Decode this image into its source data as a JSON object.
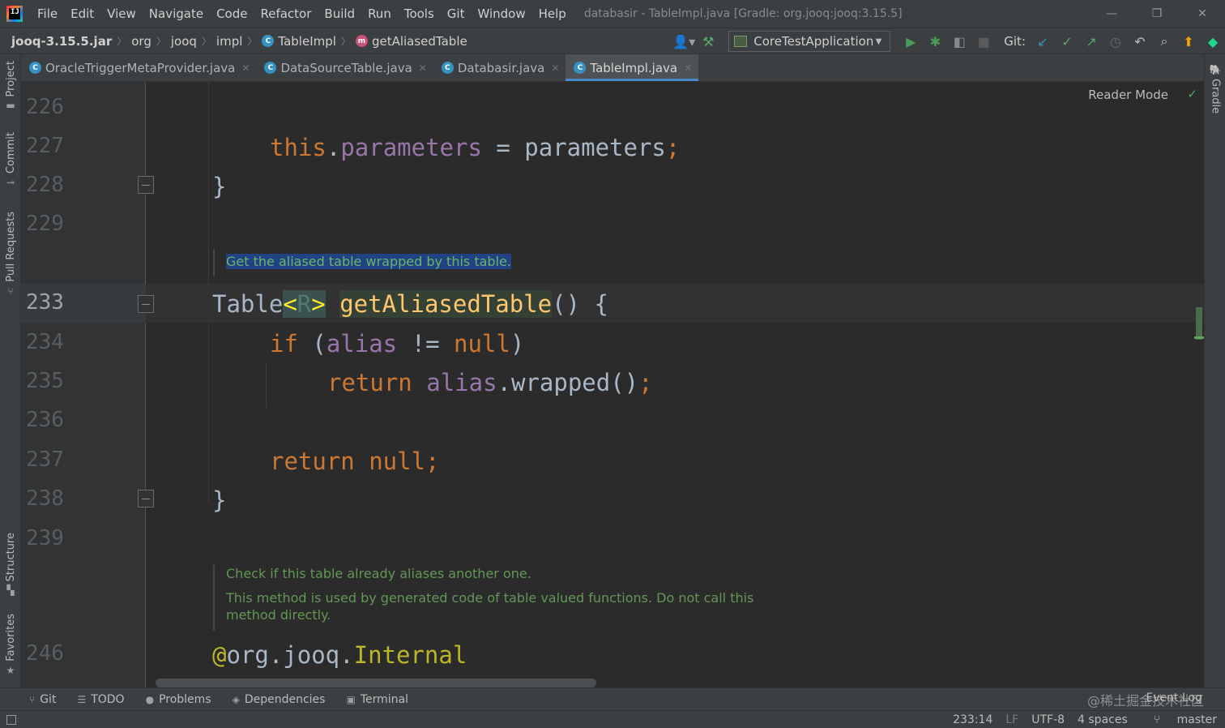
{
  "window": {
    "title": "databasir - TableImpl.java [Gradle: org.jooq:jooq:3.15.5]",
    "menu": [
      "File",
      "Edit",
      "View",
      "Navigate",
      "Code",
      "Refactor",
      "Build",
      "Run",
      "Tools",
      "Git",
      "Window",
      "Help"
    ],
    "controls": [
      "—",
      "❐",
      "✕"
    ]
  },
  "breadcrumbs": [
    "jooq-3.15.5.jar",
    "org",
    "jooq",
    "impl",
    "TableImpl",
    "getAliasedTable"
  ],
  "toolbar": {
    "run_config": "CoreTestApplication",
    "git_label": "Git:"
  },
  "tabs": [
    {
      "label": "OracleTriggerMetaProvider.java"
    },
    {
      "label": "DataSourceTable.java"
    },
    {
      "label": "Databasir.java"
    },
    {
      "label": "TableImpl.java",
      "active": true
    }
  ],
  "side_tools": {
    "left_top": [
      "Project",
      "Commit",
      "Pull Requests"
    ],
    "left_bottom": [
      "Structure",
      "Favorites"
    ],
    "right": [
      "Gradle"
    ]
  },
  "editor": {
    "reader_mode": "Reader Mode",
    "lines": [
      {
        "num": "226"
      },
      {
        "num": "227",
        "code": "this.parameters = parameters;"
      },
      {
        "num": "228",
        "code": "}"
      },
      {
        "num": "229"
      },
      {
        "num": "233",
        "code": "Table<R> getAliasedTable() {"
      },
      {
        "num": "234",
        "code": "if (alias != null)"
      },
      {
        "num": "235",
        "code": "return alias.wrapped();"
      },
      {
        "num": "236"
      },
      {
        "num": "237",
        "code": "return null;"
      },
      {
        "num": "238",
        "code": "}"
      },
      {
        "num": "239"
      },
      {
        "num": "246",
        "code": "@org.jooq.Internal"
      }
    ],
    "doc1": "Get the aliased table wrapped by this table.",
    "doc2_line1": "Check if this table already aliases another one.",
    "doc2_line2": "This method is used by generated code of table valued functions. Do not call this method directly."
  },
  "bottom_tools": [
    "Git",
    "TODO",
    "Problems",
    "Dependencies",
    "Terminal"
  ],
  "event_log": "Event Log",
  "watermark": "@稀土掘金技术社区",
  "status": {
    "position": "233:14",
    "line_sep": "LF",
    "encoding": "UTF-8",
    "indent": "4 spaces",
    "branch": "master"
  }
}
